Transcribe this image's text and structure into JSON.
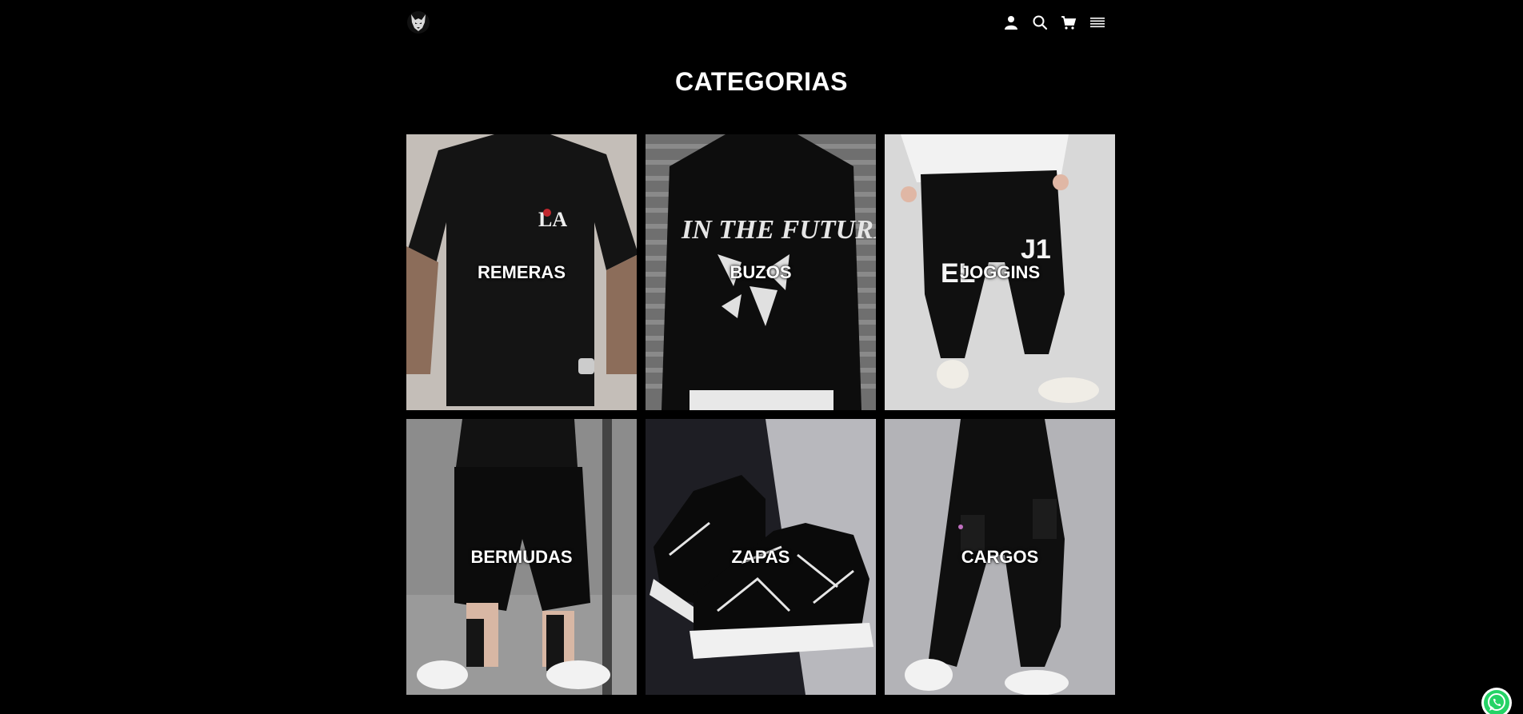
{
  "header": {
    "logo_icon": "wolf-logo-icon",
    "icons": [
      "user-icon",
      "search-icon",
      "cart-icon",
      "menu-icon"
    ]
  },
  "page": {
    "title": "CATEGORIAS"
  },
  "categories": [
    {
      "label": "REMERAS"
    },
    {
      "label": "BUZOS"
    },
    {
      "label": "JOGGINS"
    },
    {
      "label": "BERMUDAS"
    },
    {
      "label": "ZAPAS"
    },
    {
      "label": "CARGOS"
    }
  ],
  "colors": {
    "background": "#000000",
    "text": "#ffffff",
    "whatsapp": "#25d366"
  },
  "floating": {
    "whatsapp_icon": "whatsapp-icon"
  }
}
